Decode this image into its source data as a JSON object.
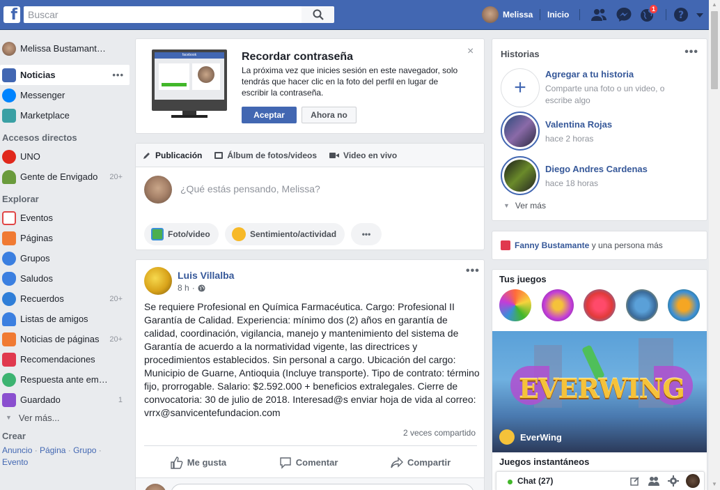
{
  "topbar": {
    "logo": "f",
    "search_placeholder": "Buscar",
    "user_name": "Melissa",
    "home": "Inicio",
    "notifications_count": "1",
    "icons": [
      "friend-requests-icon",
      "messenger-icon",
      "globe-notifications-icon",
      "help-icon",
      "caret-down-icon"
    ]
  },
  "sidebar": {
    "profile_name": "Melissa Bustamant…",
    "main": [
      {
        "label": "Noticias",
        "icon": "news-feed-icon",
        "color": "#4267b2"
      },
      {
        "label": "Messenger",
        "icon": "messenger-icon",
        "color": "#0084ff"
      },
      {
        "label": "Marketplace",
        "icon": "marketplace-icon",
        "color": "#3aa0a4"
      }
    ],
    "shortcuts_title": "Accesos directos",
    "shortcuts": [
      {
        "label": "UNO",
        "count": "",
        "color": "#e0281c"
      },
      {
        "label": "Gente de Envigado",
        "count": "20+",
        "color": "#6a9b3c"
      }
    ],
    "explore_title": "Explorar",
    "explore": [
      {
        "label": "Eventos",
        "count": "",
        "icon": "calendar-icon",
        "color": "#e04646"
      },
      {
        "label": "Páginas",
        "count": "",
        "icon": "flag-icon",
        "color": "#f07a33"
      },
      {
        "label": "Grupos",
        "count": "",
        "icon": "groups-icon",
        "color": "#3b7fe0"
      },
      {
        "label": "Saludos",
        "count": "",
        "icon": "wave-hand-icon",
        "color": "#3b7fe0"
      },
      {
        "label": "Recuerdos",
        "count": "20+",
        "icon": "memories-icon",
        "color": "#2f7ed8"
      },
      {
        "label": "Listas de amigos",
        "count": "",
        "icon": "friend-list-icon",
        "color": "#3b7fe0"
      },
      {
        "label": "Noticias de páginas",
        "count": "20+",
        "icon": "pages-feed-icon",
        "color": "#f07a33"
      },
      {
        "label": "Recomendaciones",
        "count": "",
        "icon": "recommendations-icon",
        "color": "#e0394e"
      },
      {
        "label": "Respuesta ante em…",
        "count": "",
        "icon": "crisis-response-icon",
        "color": "#3cb371"
      },
      {
        "label": "Guardado",
        "count": "1",
        "icon": "saved-icon",
        "color": "#8a4fcf"
      }
    ],
    "see_more": "Ver más...",
    "create_title": "Crear",
    "create_links": [
      "Anuncio",
      "Página",
      "Grupo",
      "Evento"
    ]
  },
  "password_card": {
    "title": "Recordar contraseña",
    "text": "La próxima vez que inicies sesión en este navegador, solo tendrás que hacer clic en la foto del perfil en lugar de escribir la contraseña.",
    "accept": "Aceptar",
    "not_now": "Ahora no",
    "illustration_brand": "facebook",
    "close": "×"
  },
  "composer": {
    "tabs": [
      "Publicación",
      "Álbum de fotos/videos",
      "Video en vivo"
    ],
    "placeholder": "¿Qué estás pensando, Melissa?",
    "actions": [
      "Foto/video",
      "Sentimiento/actividad"
    ],
    "more": "•••"
  },
  "post": {
    "author": "Luis Villalba",
    "time": "8 h",
    "text": "Se requiere Profesional en Química Farmacéutica. Cargo: Profesional II Garantía de Calidad. Experiencia: mínimo dos (2) años en garantía de calidad, coordinación, vigilancia, manejo y mantenimiento del sistema de Garantía de acuerdo a la normatividad vigente, las directrices y procedimientos establecidos. Sin personal a cargo. Ubicación del cargo: Municipio de Guarne, Antioquia (Incluye transporte). Tipo de contrato: término fijo, prorrogable. Salario: $2.592.000 + beneficios extralegales. Cierre de convocatoria: 30 de julio de 2018. Interesad@s enviar hoja de vida al correo: vrrx@sanvicentefundacion.com",
    "shares": "2 veces compartido",
    "actions": [
      "Me gusta",
      "Comentar",
      "Compartir"
    ]
  },
  "stories": {
    "title": "Historias",
    "add_title": "Agregar a tu historia",
    "add_sub": "Comparte una foto o un video, o escribe algo",
    "items": [
      {
        "name": "Valentina Rojas",
        "time": "hace 2 horas"
      },
      {
        "name": "Diego Andres Cardenas",
        "time": "hace 18 horas"
      }
    ],
    "see_more": "Ver más"
  },
  "birthday": {
    "name": "Fanny Bustamante",
    "rest": "y una persona más"
  },
  "games": {
    "title": "Tus juegos",
    "featured": "EverWing",
    "banner_logo": "EVERWING",
    "instant_title": "Juegos instantáneos",
    "icon_colors": [
      "#ff6b3b",
      "#c23dd8",
      "#e23a3a",
      "#3a8fd8",
      "#f5a623"
    ]
  },
  "chat": {
    "label": "Chat (27)"
  }
}
